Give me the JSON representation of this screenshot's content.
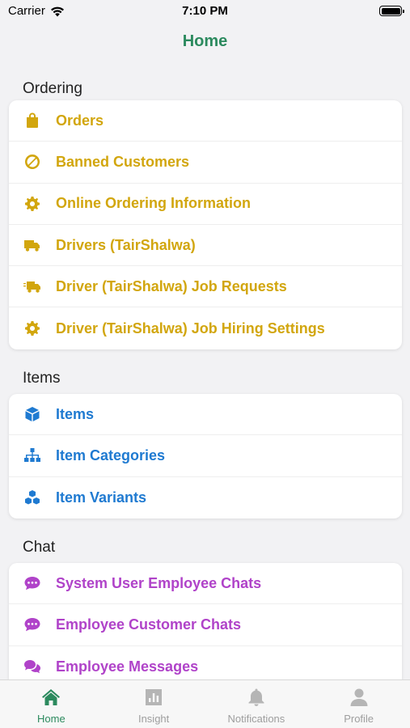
{
  "status": {
    "carrier": "Carrier",
    "time": "7:10 PM"
  },
  "nav": {
    "title": "Home"
  },
  "sections": {
    "ordering": {
      "title": "Ordering",
      "color": "#d2a60e",
      "items": [
        {
          "label": "Orders",
          "icon": "shopping-bag-icon"
        },
        {
          "label": "Banned Customers",
          "icon": "ban-icon"
        },
        {
          "label": "Online Ordering Information",
          "icon": "gear-icon"
        },
        {
          "label": "Drivers (TairShalwa)",
          "icon": "truck-icon"
        },
        {
          "label": "Driver (TairShalwa) Job Requests",
          "icon": "fast-truck-icon"
        },
        {
          "label": "Driver (TairShalwa) Job Hiring Settings",
          "icon": "gear-icon"
        }
      ]
    },
    "items": {
      "title": "Items",
      "color": "#1f7ad1",
      "items": [
        {
          "label": "Items",
          "icon": "cube-icon"
        },
        {
          "label": "Item Categories",
          "icon": "sitemap-icon"
        },
        {
          "label": "Item Variants",
          "icon": "cubes-icon"
        }
      ]
    },
    "chat": {
      "title": "Chat",
      "color": "#b043c9",
      "items": [
        {
          "label": "System User Employee Chats",
          "icon": "comment-dots-icon"
        },
        {
          "label": "Employee Customer Chats",
          "icon": "comment-dots-icon"
        },
        {
          "label": "Employee Messages",
          "icon": "comments-icon"
        }
      ]
    }
  },
  "tabs": [
    {
      "label": "Home",
      "icon": "home-icon",
      "active": true
    },
    {
      "label": "Insight",
      "icon": "chart-icon",
      "active": false
    },
    {
      "label": "Notifications",
      "icon": "bell-icon",
      "active": false
    },
    {
      "label": "Profile",
      "icon": "user-icon",
      "active": false
    }
  ],
  "colors": {
    "accent": "#2c8a5e",
    "inactive": "#9e9e9e"
  }
}
